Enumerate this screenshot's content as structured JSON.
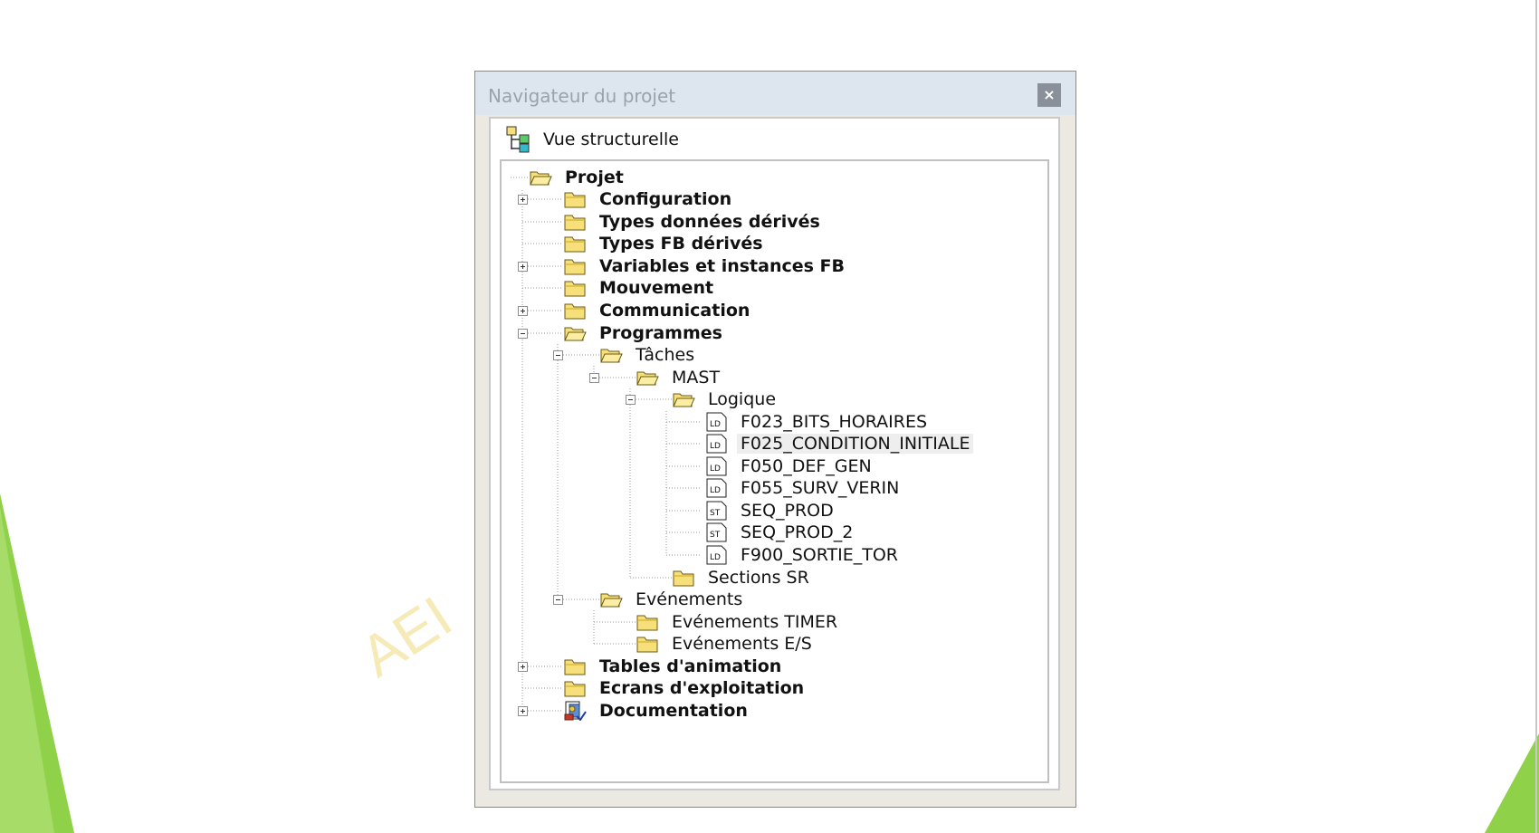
{
  "window": {
    "title": "Navigateur du projet",
    "close_label": "×"
  },
  "view": {
    "label": "Vue structurelle"
  },
  "watermark": "AEI",
  "colors": {
    "folder_fill": "#f7e07a",
    "folder_stroke": "#6b5a14",
    "accent_green": "#8fd24a",
    "titlebar": "#dde6ef"
  },
  "tree": {
    "root": "Projet",
    "configuration": "Configuration",
    "types_donnees": "Types données dérivés",
    "types_fb": "Types FB dérivés",
    "variables": "Variables et instances FB",
    "mouvement": "Mouvement",
    "communication": "Communication",
    "programmes": "Programmes",
    "taches": "Tâches",
    "mast": "MAST",
    "logique": "Logique",
    "f023": "F023_BITS_HORAIRES",
    "f025": "F025_CONDITION_INITIALE",
    "f050": "F050_DEF_GEN",
    "f055": "F055_SURV_VERIN",
    "seq_prod": "SEQ_PROD",
    "seq_prod_2": "SEQ_PROD_2",
    "f900": "F900_SORTIE_TOR",
    "sections_sr": "Sections SR",
    "evenements": "Evénements",
    "ev_timer": "Evénements TIMER",
    "ev_es": "Evénements E/S",
    "tables": "Tables d'animation",
    "ecrans": "Ecrans d'exploitation",
    "documentation": "Documentation",
    "badge_ld": "LD",
    "badge_st": "ST"
  }
}
